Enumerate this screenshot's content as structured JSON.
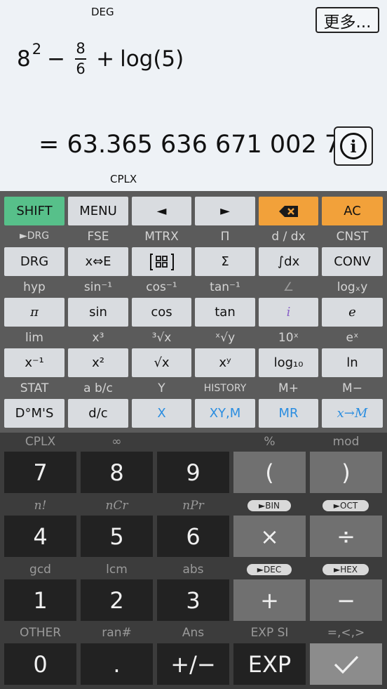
{
  "display": {
    "angle_mode": "DEG",
    "more_label": "更多...",
    "expression": {
      "base": "8",
      "exp": "2",
      "minus": "−",
      "num": "8",
      "den": "6",
      "plus": "+",
      "log": "log(5)"
    },
    "result": "= 63.365 636 671 002 7",
    "complex_mode": "CPLX",
    "info_icon": "info-circle-icon"
  },
  "rows": {
    "r1": {
      "shift": "SHIFT",
      "menu": "MENU",
      "left": "◄",
      "right": "►",
      "backspace_icon": "backspace-icon",
      "ac": "AC"
    },
    "r1_labels": [
      "►DRG",
      "FSE",
      "MTRX",
      "Π",
      "d / dx",
      "CNST"
    ],
    "r2": {
      "drg": "DRG",
      "xe": "x⇔E",
      "matrix_icon": "matrix-icon",
      "sigma": "Σ",
      "integral": "∫dx",
      "conv": "CONV"
    },
    "r2_labels": [
      "hyp",
      "sin⁻¹",
      "cos⁻¹",
      "tan⁻¹",
      "∠",
      "logₓy"
    ],
    "r3": {
      "pi": "π",
      "sin": "sin",
      "cos": "cos",
      "tan": "tan",
      "i": "i",
      "e": "e"
    },
    "r3_labels": [
      "lim",
      "x³",
      "³√x",
      "ˣ√y",
      "10ˣ",
      "eˣ"
    ],
    "r4": {
      "inv": "x⁻¹",
      "sq": "x²",
      "sqrt": "√x",
      "pow": "xʸ",
      "log10": "log₁₀",
      "ln": "ln"
    },
    "r4_labels": [
      "STAT",
      "a b/c",
      "Y",
      "HISTORY",
      "M+",
      "M−"
    ],
    "r5": {
      "dms": "D°M'S",
      "dc": "d/c",
      "x": "X",
      "xym": "XY,M",
      "mr": "MR",
      "xm": "x→M"
    }
  },
  "numpad": {
    "labels1": [
      "CPLX",
      "∞",
      "",
      "%",
      "mod"
    ],
    "row1": [
      "7",
      "8",
      "9",
      "(",
      ")"
    ],
    "labels2": [
      "n!",
      "nCr",
      "nPr",
      "►BIN",
      "►OCT"
    ],
    "row2": [
      "4",
      "5",
      "6",
      "×",
      "÷"
    ],
    "labels3": [
      "gcd",
      "lcm",
      "abs",
      "►DEC",
      "►HEX"
    ],
    "row3": [
      "1",
      "2",
      "3",
      "+",
      "−"
    ],
    "labels4": [
      "OTHER",
      "ran#",
      "Ans",
      "EXP SI",
      "=,<,>"
    ],
    "row4": [
      "0",
      ".",
      "+/−",
      "EXP"
    ],
    "check_icon": "check-icon"
  }
}
